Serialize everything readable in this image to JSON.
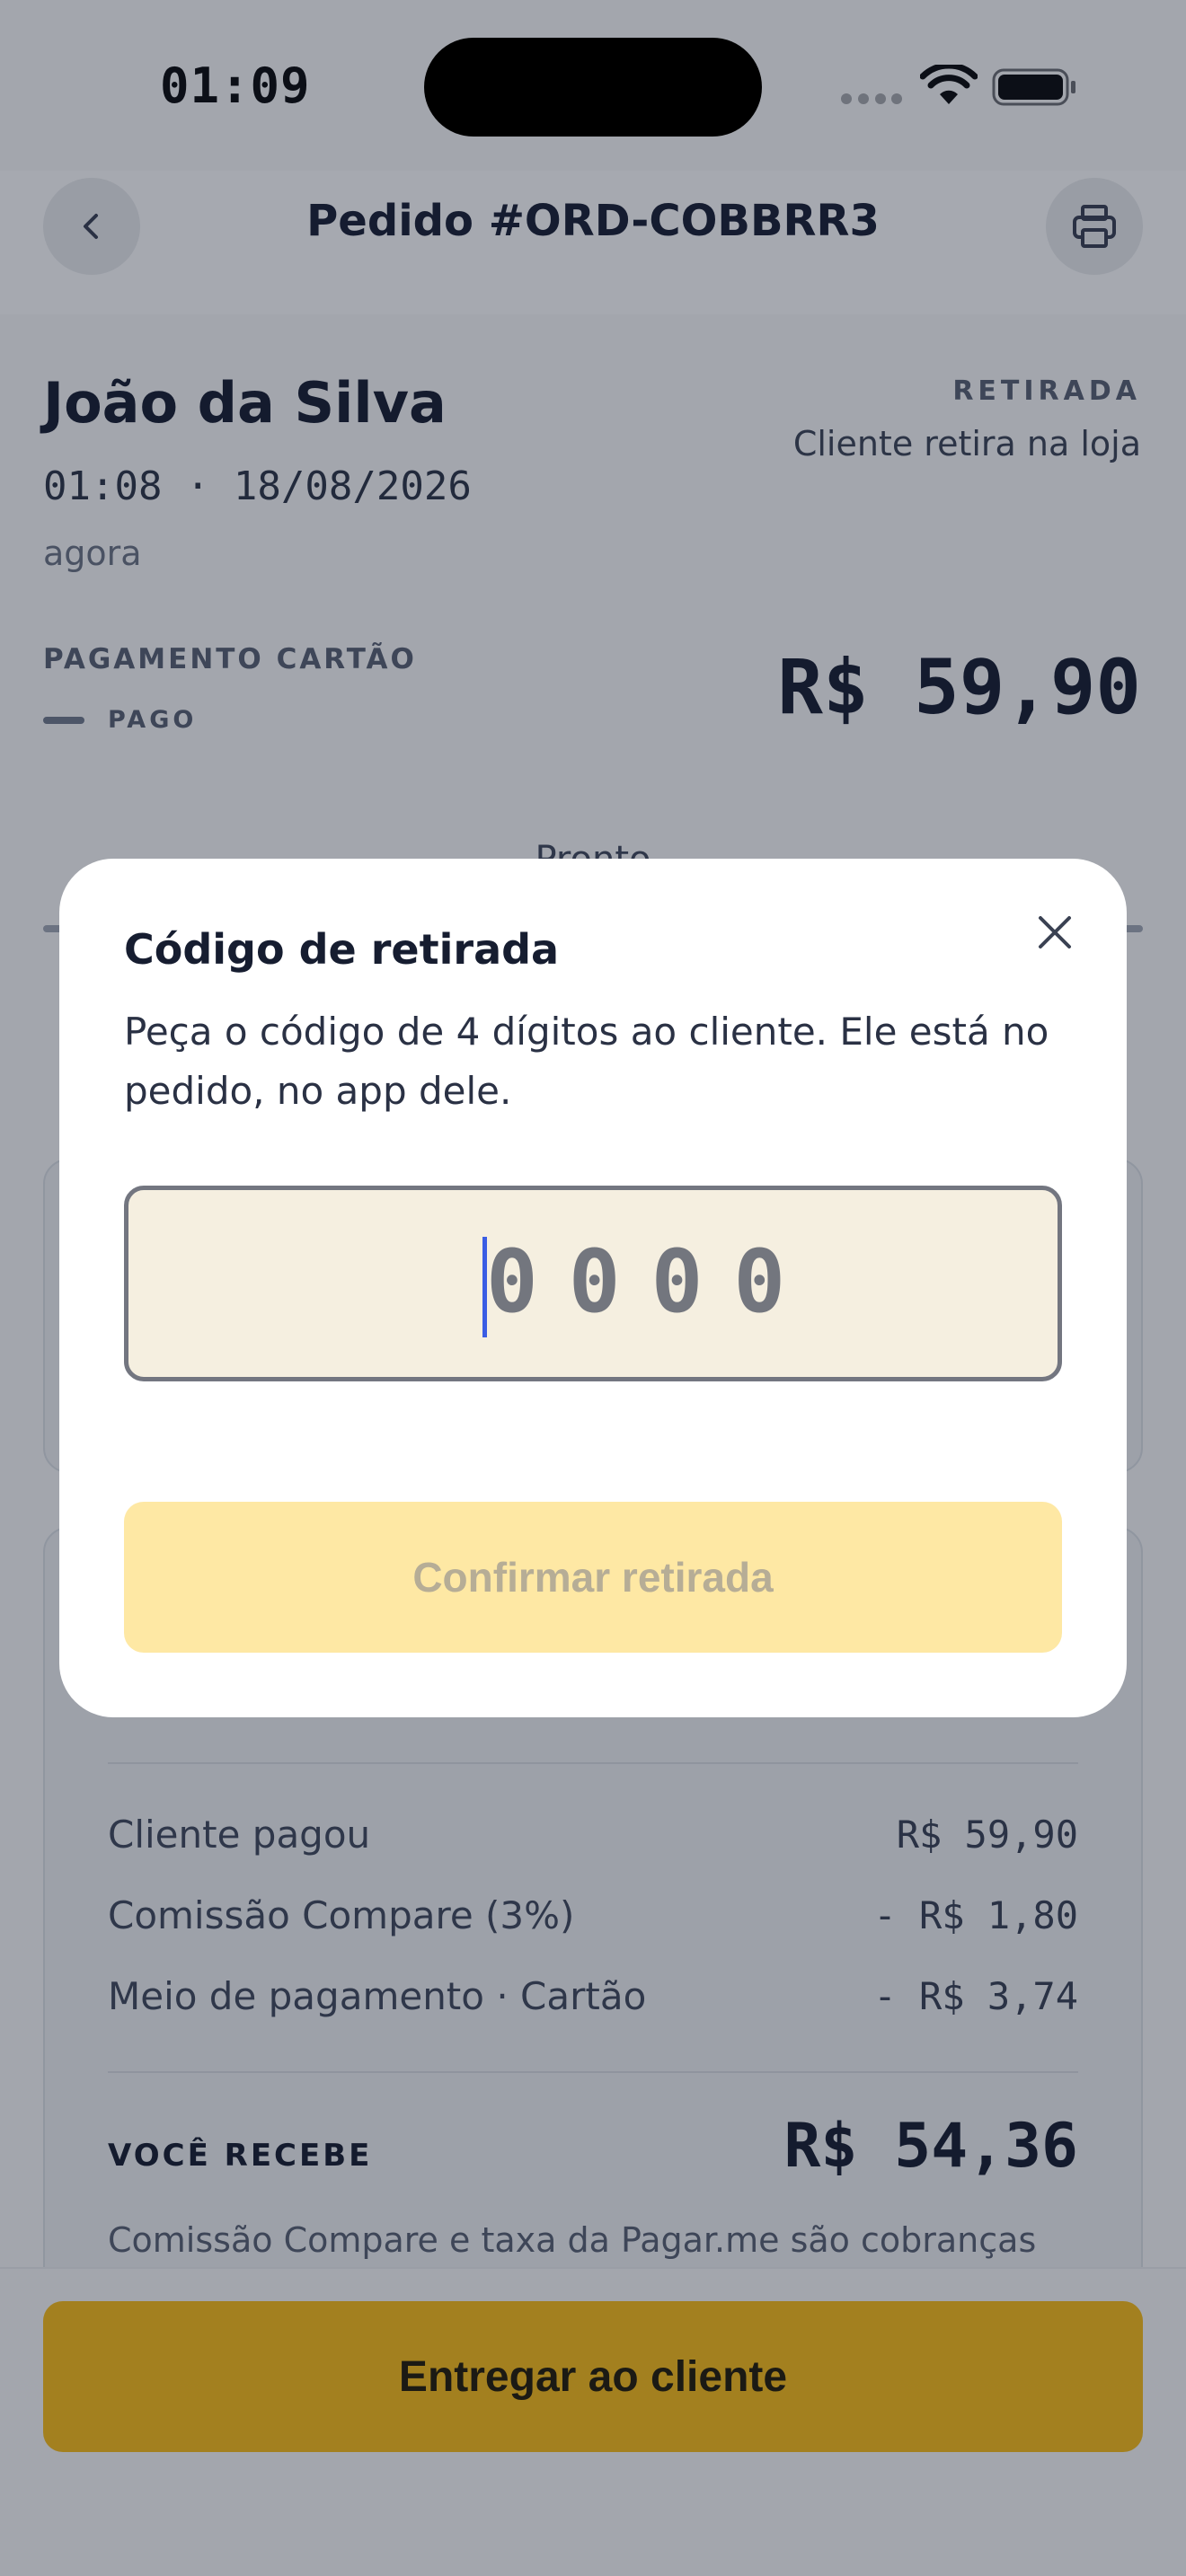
{
  "status_bar": {
    "time": "01:09"
  },
  "header": {
    "title": "Pedido #ORD-COBBRR3"
  },
  "order": {
    "customer_name": "João da Silva",
    "datetime": "01:08 · 18/08/2026",
    "relative_time": "agora",
    "fulfillment_type": "RETIRADA",
    "fulfillment_desc": "Cliente retira na loja",
    "payment_method": "PAGAMENTO CARTÃO",
    "payment_status": "PAGO",
    "total": "R$ 59,90"
  },
  "tabs": {
    "active_label": "Pronto"
  },
  "breakdown": {
    "rows": [
      {
        "label": "Cliente pagou",
        "value": "R$ 59,90"
      },
      {
        "label": "Comissão Compare (3%)",
        "value": "- R$ 1,80"
      },
      {
        "label": "Meio de pagamento · Cartão",
        "value": "- R$ 3,74"
      }
    ],
    "you_receive_label": "VOCÊ RECEBE",
    "you_receive_value": "R$ 54,36",
    "fee_note": "Comissão Compare e taxa da Pagar.me são cobranças"
  },
  "bottom": {
    "deliver_label": "Entregar ao cliente"
  },
  "modal": {
    "title": "Código de retirada",
    "description": "Peça o código de 4 dígitos ao cliente. Ele está no pedido, no app dele.",
    "code_placeholder": "0000",
    "confirm_label": "Confirmar retirada"
  },
  "colors": {
    "accent": "#a3801f",
    "confirm_disabled": "#fee8a4",
    "input_bg": "#f5efe0",
    "cursor": "#3a5de4"
  },
  "icons": {
    "back": "chevron-left-icon",
    "print": "printer-icon",
    "close": "close-icon",
    "wifi": "wifi-icon",
    "battery": "battery-icon"
  }
}
